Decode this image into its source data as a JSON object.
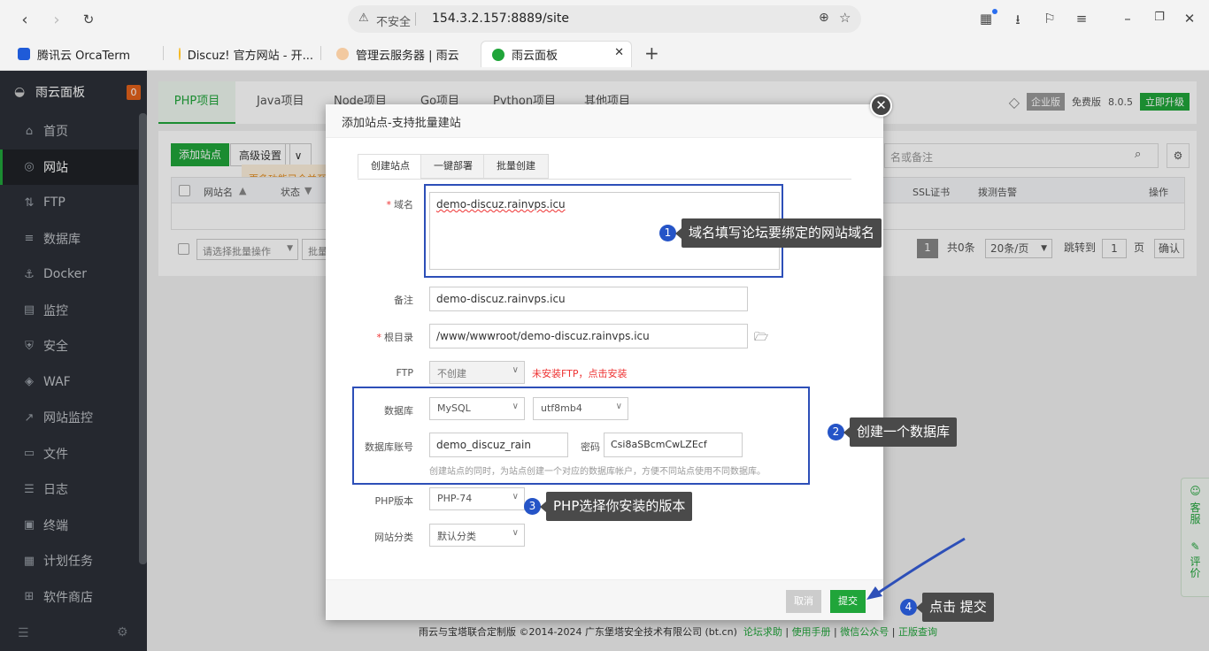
{
  "browser": {
    "url": "154.3.2.157:8889/site",
    "insecure_label": "不安全",
    "tabs": [
      {
        "label": "腾讯云 OrcaTerm"
      },
      {
        "label": "Discuz! 官方网站 - 开..."
      },
      {
        "label": "管理云服务器 | 雨云"
      },
      {
        "label": "雨云面板"
      }
    ]
  },
  "sidebar": {
    "title": "雨云面板",
    "badge": "0",
    "items": [
      {
        "label": "首页",
        "icon": "home-icon"
      },
      {
        "label": "网站",
        "icon": "globe-icon"
      },
      {
        "label": "FTP",
        "icon": "ftp-icon"
      },
      {
        "label": "数据库",
        "icon": "database-icon"
      },
      {
        "label": "Docker",
        "icon": "docker-icon"
      },
      {
        "label": "监控",
        "icon": "monitor-icon"
      },
      {
        "label": "安全",
        "icon": "shield-icon"
      },
      {
        "label": "WAF",
        "icon": "waf-icon"
      },
      {
        "label": "网站监控",
        "icon": "chart-icon"
      },
      {
        "label": "文件",
        "icon": "folder-icon"
      },
      {
        "label": "日志",
        "icon": "log-icon"
      },
      {
        "label": "终端",
        "icon": "terminal-icon"
      },
      {
        "label": "计划任务",
        "icon": "calendar-icon"
      },
      {
        "label": "软件商店",
        "icon": "store-icon"
      }
    ]
  },
  "panel": {
    "tabs": [
      "PHP项目",
      "Java项目",
      "Node项目",
      "Go项目",
      "Python项目",
      "其他项目"
    ],
    "edition": "企业版",
    "free": "免费版",
    "version": "8.0.5",
    "upgrade": "立即升级",
    "add_site": "添加站点",
    "advanced": "高级设置",
    "tip": "更多功能已合并至高级设置",
    "search_placeholder": "名或备注",
    "columns": {
      "name": "网站名",
      "status": "状态",
      "ssl": "SSL证书",
      "alert": "拨测告警",
      "ops": "操作"
    },
    "batch_placeholder": "请选择批量操作",
    "batch_btn": "批量",
    "page": "1",
    "total": "共0条",
    "per_page": "20条/页",
    "jump": "跳转到",
    "jump_page": "1",
    "page_unit": "页",
    "confirm": "确认"
  },
  "footer": {
    "copyright": "雨云与宝塔联合定制版 ©2014-2024 广东堡塔安全技术有限公司 (bt.cn)",
    "links": [
      "论坛求助",
      "使用手册",
      "微信公众号",
      "正版查询"
    ]
  },
  "float_widget": {
    "service": "客服",
    "review": "评价"
  },
  "modal": {
    "title": "添加站点-支持批量建站",
    "tabs": [
      "创建站点",
      "一键部署",
      "批量创建"
    ],
    "domain_label": "域名",
    "domain_value": "demo-discuz.rainvps.icu",
    "remark_label": "备注",
    "remark_value": "demo-discuz.rainvps.icu",
    "root_label": "根目录",
    "root_value": "/www/wwwroot/demo-discuz.rainvps.icu",
    "ftp_label": "FTP",
    "ftp_value": "不创建",
    "ftp_hint": "未安装FTP，点击安装",
    "db_label": "数据库",
    "db_type": "MySQL",
    "db_charset": "utf8mb4",
    "db_account_label": "数据库账号",
    "db_account": "demo_discuz_rain",
    "pwd_label": "密码",
    "pwd_value": "Csi8aSBcmCwLZEcf",
    "db_hint": "创建站点的同时，为站点创建一个对应的数据库帐户，方便不同站点使用不同数据库。",
    "php_label": "PHP版本",
    "php_value": "PHP-74",
    "category_label": "网站分类",
    "category_value": "默认分类",
    "cancel": "取消",
    "submit": "提交"
  },
  "annotations": [
    {
      "num": "1",
      "text": "域名填写论坛要绑定的网站域名"
    },
    {
      "num": "2",
      "text": "创建一个数据库"
    },
    {
      "num": "3",
      "text": "PHP选择你安装的版本"
    },
    {
      "num": "4",
      "text": "点击 提交"
    }
  ],
  "colors": {
    "brand_green": "#20a53a",
    "annotation_blue": "#2d4fb8",
    "sidebar_bg": "#2c3038"
  }
}
